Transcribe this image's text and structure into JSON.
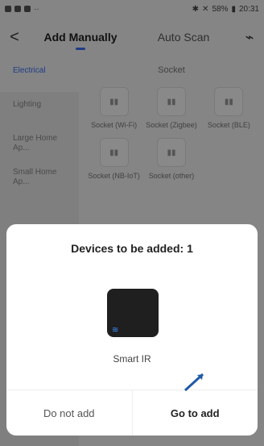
{
  "status": {
    "time": "20:31",
    "battery": "58%"
  },
  "header": {
    "back": "<",
    "tab_manual": "Add Manually",
    "tab_auto": "Auto Scan"
  },
  "sidebar": {
    "items": [
      {
        "label": "Electrical"
      },
      {
        "label": "Lighting"
      },
      {
        "label": "Large Home Ap..."
      },
      {
        "label": "Small Home Ap..."
      }
    ]
  },
  "content": {
    "section": "Socket",
    "devices": [
      {
        "label": "Socket (Wi-Fi)"
      },
      {
        "label": "Socket (Zigbee)"
      },
      {
        "label": "Socket (BLE)"
      },
      {
        "label": "Socket (NB-IoT)"
      },
      {
        "label": "Socket (other)"
      }
    ]
  },
  "dialog": {
    "title": "Devices to be added: 1",
    "device_name": "Smart IR",
    "btn_cancel": "Do not add",
    "btn_add": "Go to add"
  }
}
